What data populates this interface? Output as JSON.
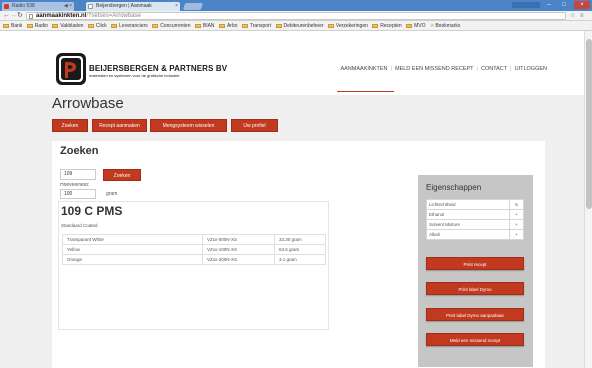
{
  "browser": {
    "tabs": [
      {
        "title": "Radio 538",
        "audio_icon": "◀ ×"
      },
      {
        "title": "Beijersbergen | Aanmaak"
      }
    ],
    "url_host": "aanmaakinkten.nl",
    "url_path": "/?setses=Arrowbase",
    "bookmarks": [
      "Bank",
      "Radio",
      "Vakbladen",
      "Click",
      "Leveranciers",
      "Concurrenten",
      "BIAN",
      "Arbo",
      "Transport",
      "Debiteurenbeheer",
      "Verzekeringen",
      "Recepten",
      "MVO",
      "Bookmarks"
    ],
    "window": {
      "minimize": "–",
      "maximize": "□",
      "close": "×"
    }
  },
  "site": {
    "logo_name": "BEIJERSBERGEN & PARTNERS BV",
    "logo_tagline": "materialen en systemen voor de grafische industrie",
    "nav": [
      "AANMAAKINKTEN",
      "MELD EEN MISSEND RECEPT",
      "CONTACT",
      "UITLOGGEN"
    ]
  },
  "page": {
    "title": "Arrowbase",
    "menu": [
      "Zoeken",
      "Recept aanmaken",
      "Mengsysteem wisselen",
      "Uw profiel"
    ]
  },
  "search": {
    "title": "Zoeken",
    "input_value": "109",
    "button": "Zoeken",
    "qty_label": "Hoeveelheid:",
    "qty_value": "100",
    "qty_unit": "gram"
  },
  "result": {
    "title": "109 C PMS",
    "subtitle": "Standaard Coated",
    "rows": [
      [
        "Transparant White",
        "VZxx-000N-XS",
        "33.30 gram"
      ],
      [
        "Yellow",
        "VZxx-100N-XS",
        "63.6 gram"
      ],
      [
        "Orange",
        "VZxx-200N-XS",
        "3.1 gram"
      ]
    ]
  },
  "sidebar": {
    "title": "Eigenschappen",
    "properties": [
      [
        "Lichtechtheid",
        "5"
      ],
      [
        "Ethanol",
        "+"
      ],
      [
        "Solvent Mixture",
        "+"
      ],
      [
        "Alkali",
        "+"
      ]
    ],
    "buttons": [
      "Print recept",
      "Print label Dymo",
      "Print label Dymo aanpasbaar",
      "Meld een missend recept"
    ]
  },
  "colors": {
    "accent": "#c1391f",
    "chrome_blue": "#4c84c8",
    "sidebar_gray": "#c6c6c6"
  }
}
